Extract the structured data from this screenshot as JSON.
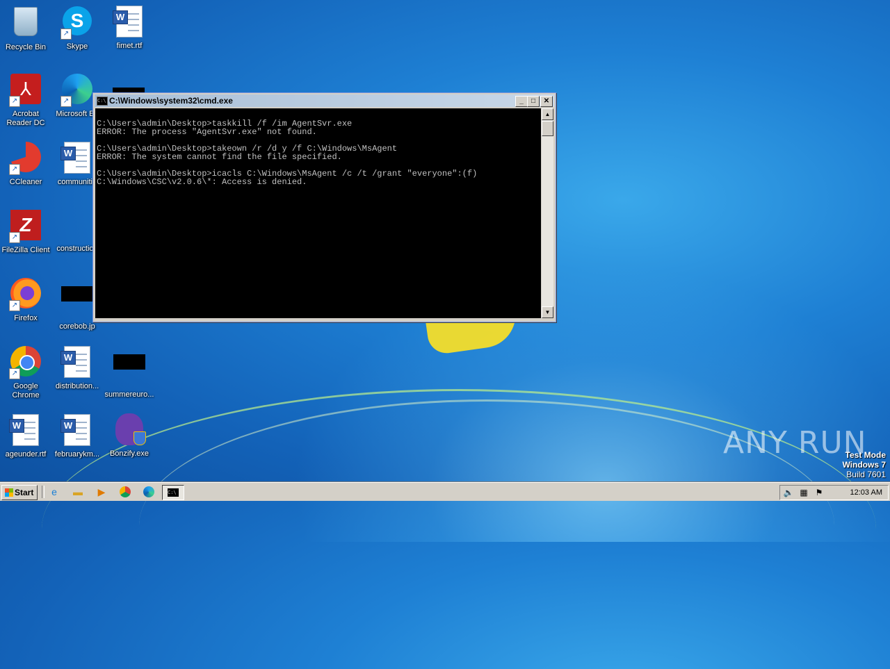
{
  "desktop": {
    "icons": [
      {
        "label": "Recycle Bin"
      },
      {
        "label": "Skype"
      },
      {
        "label": "fimet.rtf"
      },
      {
        "label": "Acrobat Reader DC"
      },
      {
        "label": "Microsoft Ed"
      },
      {
        "label": "CCleaner"
      },
      {
        "label": "communitie"
      },
      {
        "label": "FileZilla Client"
      },
      {
        "label": "construction"
      },
      {
        "label": "Firefox"
      },
      {
        "label": "corebob.jp"
      },
      {
        "label": "Google Chrome"
      },
      {
        "label": "distribution..."
      },
      {
        "label": "summereuro..."
      },
      {
        "label": "ageunder.rtf"
      },
      {
        "label": "februarykm..."
      },
      {
        "label": "Bonzify.exe"
      }
    ]
  },
  "cmd_window": {
    "title": "C:\\Windows\\system32\\cmd.exe",
    "output": "\nC:\\Users\\admin\\Desktop>taskkill /f /im AgentSvr.exe\nERROR: The process \"AgentSvr.exe\" not found.\n\nC:\\Users\\admin\\Desktop>takeown /r /d y /f C:\\Windows\\MsAgent\nERROR: The system cannot find the file specified.\n\nC:\\Users\\admin\\Desktop>icacls C:\\Windows\\MsAgent /c /t /grant \"everyone\":(f)\nC:\\Windows\\CSC\\v2.0.6\\*: Access is denied."
  },
  "watermark": {
    "brand": "ANY RUN",
    "test_mode": "Test Mode",
    "os": "Windows 7",
    "build": "Build 7601"
  },
  "taskbar": {
    "start_label": "Start",
    "clock": "12:03 AM"
  }
}
